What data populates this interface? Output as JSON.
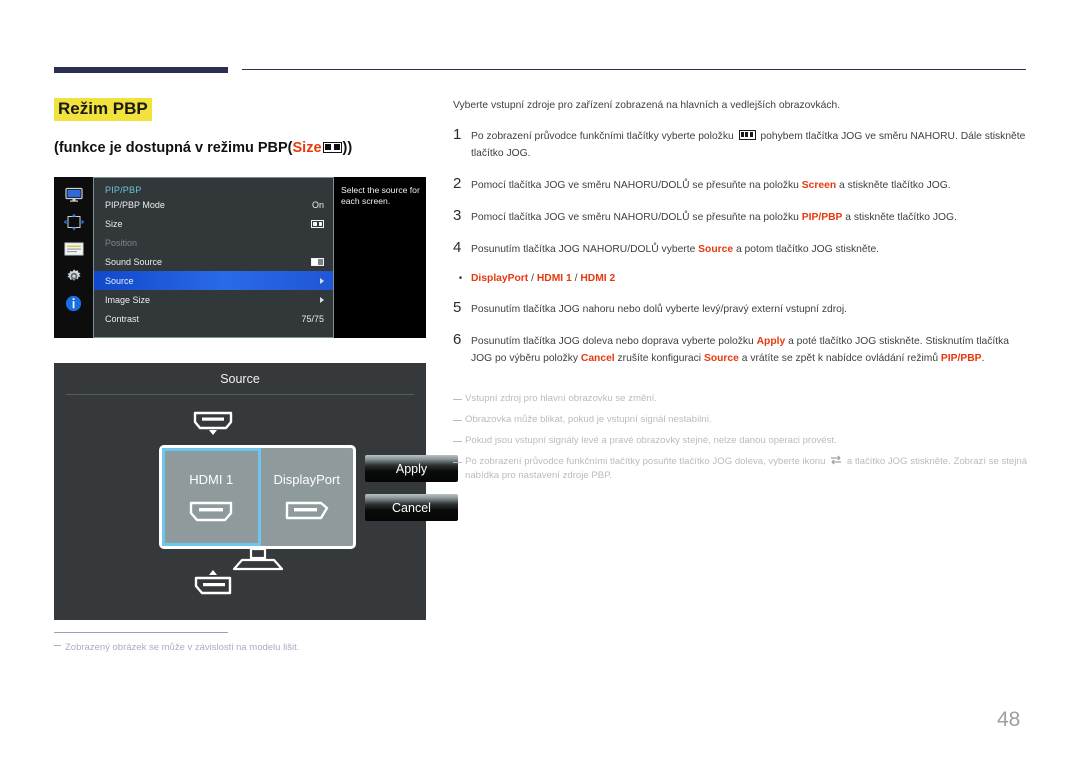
{
  "heading": {
    "title": "Režim PBP",
    "subtitle_pre": "(funkce je dostupná v režimu PBP(",
    "subtitle_red": "Size",
    "subtitle_post": "))"
  },
  "osd": {
    "menu_title": "PIP/PBP",
    "rows": [
      {
        "label": "PIP/PBP Mode",
        "value": "On",
        "type": "text"
      },
      {
        "label": "Size",
        "value": "",
        "type": "size-icon"
      },
      {
        "label": "Position",
        "value": "",
        "type": "dim"
      },
      {
        "label": "Sound Source",
        "value": "",
        "type": "sound-icon"
      },
      {
        "label": "Source",
        "value": "",
        "type": "arrow",
        "selected": true
      },
      {
        "label": "Image Size",
        "value": "",
        "type": "arrow"
      },
      {
        "label": "Contrast",
        "value": "75/75",
        "type": "text"
      }
    ],
    "help_text": "Select the source for each screen.",
    "sidebar_icons": [
      "display-icon",
      "position-icon",
      "list-icon",
      "gear-icon",
      "info-icon"
    ]
  },
  "source_dialog": {
    "title": "Source",
    "left_screen_label": "HDMI 1",
    "right_screen_label": "DisplayPort",
    "apply_label": "Apply",
    "cancel_label": "Cancel"
  },
  "image_footnote": "Zobrazený obrázek se může v závislosti na modelu lišit.",
  "content": {
    "intro": "Vyberte vstupní zdroje pro zařízení zobrazená na hlavních a vedlejších obrazovkách.",
    "steps": [
      {
        "num": "1",
        "parts": [
          {
            "t": "Po zobrazení průvodce funkčními tlačítky vyberte položku ",
            "s": "n"
          },
          {
            "t": "",
            "s": "icon-pbp"
          },
          {
            "t": " pohybem tlačítka JOG ve směru NAHORU. Dále stiskněte tlačítko JOG.",
            "s": "n"
          }
        ]
      },
      {
        "num": "2",
        "parts": [
          {
            "t": "Pomocí tlačítka JOG ve směru NAHORU/DOLŮ se přesuňte na položku ",
            "s": "n"
          },
          {
            "t": "Screen",
            "s": "r"
          },
          {
            "t": " a stiskněte tlačítko JOG.",
            "s": "n"
          }
        ]
      },
      {
        "num": "3",
        "parts": [
          {
            "t": "Pomocí tlačítka JOG ve směru NAHORU/DOLŮ se přesuňte na položku ",
            "s": "n"
          },
          {
            "t": "PIP/PBP",
            "s": "r"
          },
          {
            "t": " a stiskněte tlačítko JOG.",
            "s": "n"
          }
        ]
      },
      {
        "num": "4",
        "parts": [
          {
            "t": "Posunutím tlačítka JOG NAHORU/DOLŮ vyberte ",
            "s": "n"
          },
          {
            "t": "Source",
            "s": "r"
          },
          {
            "t": " a potom tlačítko JOG stiskněte.",
            "s": "n"
          }
        ]
      }
    ],
    "bullet": {
      "marker": "•",
      "options": [
        "DisplayPort",
        "HDMI 1",
        "HDMI 2"
      ],
      "separator": " / "
    },
    "steps2": [
      {
        "num": "5",
        "parts": [
          {
            "t": "Posunutím tlačítka JOG nahoru nebo dolů vyberte levý/pravý externí vstupní zdroj.",
            "s": "n"
          }
        ]
      },
      {
        "num": "6",
        "parts": [
          {
            "t": "Posunutím tlačítka JOG doleva nebo doprava vyberte položku ",
            "s": "n"
          },
          {
            "t": "Apply",
            "s": "r"
          },
          {
            "t": " a poté tlačítko JOG stiskněte. Stisknutím tlačítka JOG po výběru položky ",
            "s": "n"
          },
          {
            "t": "Cancel",
            "s": "r"
          },
          {
            "t": " zrušíte konfiguraci ",
            "s": "n"
          },
          {
            "t": "Source",
            "s": "r"
          },
          {
            "t": " a vrátíte se zpět k nabídce ovládání režimů ",
            "s": "n"
          },
          {
            "t": "PIP/PBP",
            "s": "r"
          },
          {
            "t": ".",
            "s": "n"
          }
        ]
      }
    ],
    "notes": [
      {
        "parts": [
          {
            "t": "Vstupní zdroj pro hlavní obrazovku se změní.",
            "s": "n"
          }
        ]
      },
      {
        "parts": [
          {
            "t": "Obrazovka může blikat, pokud je vstupní signál nestabilní.",
            "s": "n"
          }
        ]
      },
      {
        "parts": [
          {
            "t": "Pokud jsou vstupní signály levé a pravé obrazovky stejné, nelze danou operaci provést.",
            "s": "n"
          }
        ]
      },
      {
        "parts": [
          {
            "t": "Po zobrazení průvodce funkčními tlačítky posuňte tlačítko JOG doleva, vyberte ikonu ",
            "s": "n"
          },
          {
            "t": "",
            "s": "icon-swap"
          },
          {
            "t": " a tlačítko JOG stiskněte. Zobrazí se stejná nabídka pro nastavení zdroje PBP.",
            "s": "n"
          }
        ]
      }
    ]
  },
  "page_number": "48",
  "colors": {
    "accent_red": "#e8380d",
    "highlight_yellow": "#f2e23c",
    "rule_navy": "#2b3050",
    "osd_selected_blue": "#2a6ae8",
    "focus_cyan": "#6ec6ef"
  }
}
